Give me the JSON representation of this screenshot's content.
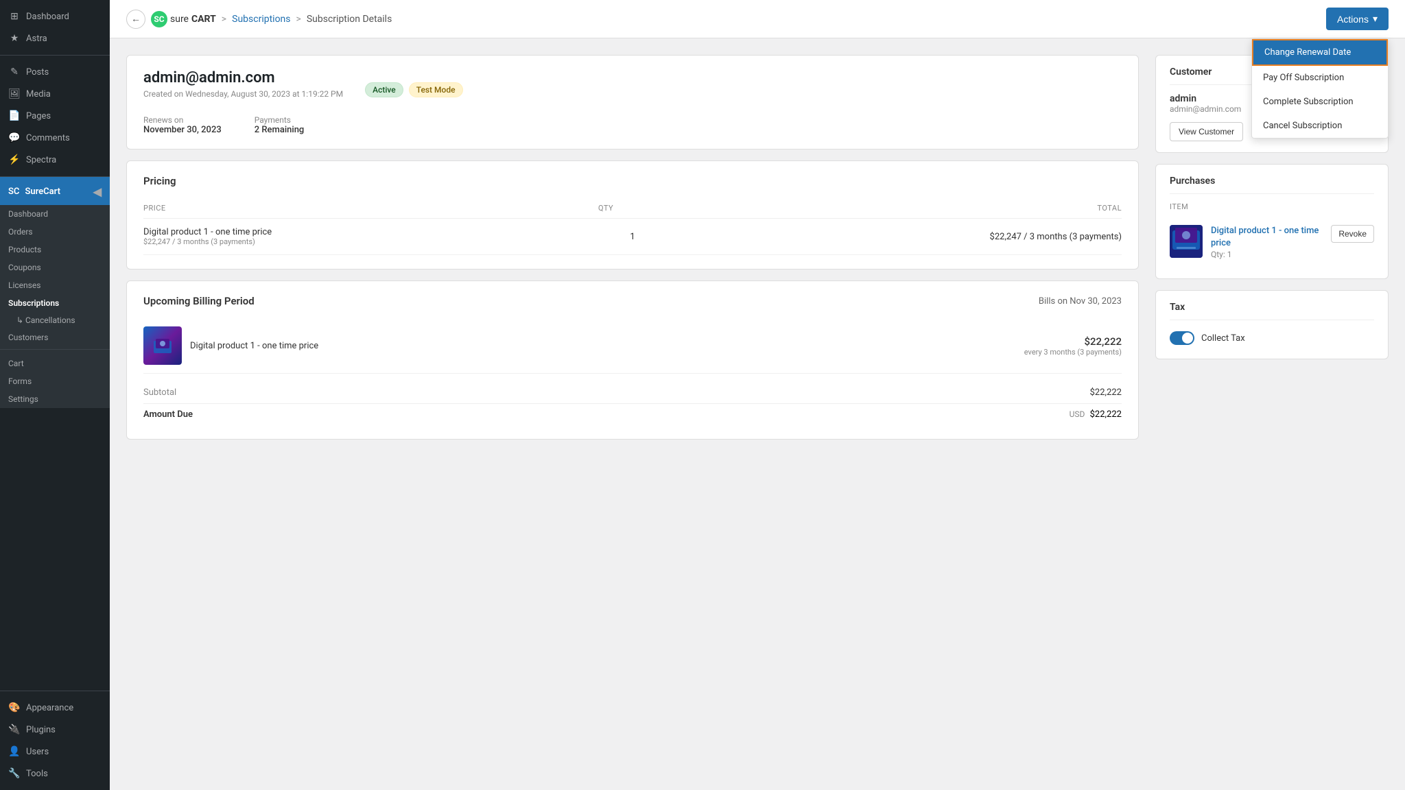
{
  "sidebar": {
    "top_items": [
      {
        "id": "dashboard",
        "label": "Dashboard",
        "icon": "⊞"
      },
      {
        "id": "astra",
        "label": "Astra",
        "icon": "★"
      }
    ],
    "wp_items": [
      {
        "id": "posts",
        "label": "Posts",
        "icon": "✎"
      },
      {
        "id": "media",
        "label": "Media",
        "icon": "🖼"
      },
      {
        "id": "pages",
        "label": "Pages",
        "icon": "📄"
      },
      {
        "id": "comments",
        "label": "Comments",
        "icon": "💬"
      },
      {
        "id": "spectra",
        "label": "Spectra",
        "icon": "⚡"
      }
    ],
    "surecart_label": "SureCart",
    "surecart_items": [
      {
        "id": "sc-dashboard",
        "label": "Dashboard"
      },
      {
        "id": "orders",
        "label": "Orders"
      },
      {
        "id": "products",
        "label": "Products"
      },
      {
        "id": "coupons",
        "label": "Coupons"
      },
      {
        "id": "licenses",
        "label": "Licenses"
      },
      {
        "id": "subscriptions",
        "label": "Subscriptions",
        "active": true
      },
      {
        "id": "cancellations",
        "label": "↳ Cancellations",
        "sub": true
      },
      {
        "id": "customers",
        "label": "Customers"
      }
    ],
    "bottom_items": [
      {
        "id": "cart",
        "label": "Cart"
      },
      {
        "id": "forms",
        "label": "Forms"
      },
      {
        "id": "settings",
        "label": "Settings"
      }
    ],
    "extra_items": [
      {
        "id": "appearance",
        "label": "Appearance",
        "icon": "🎨"
      },
      {
        "id": "plugins",
        "label": "Plugins",
        "icon": "🔌"
      },
      {
        "id": "users",
        "label": "Users",
        "icon": "👤"
      },
      {
        "id": "tools",
        "label": "Tools",
        "icon": "🔧"
      }
    ]
  },
  "topbar": {
    "back_label": "←",
    "logo_text": "sure",
    "logo_bold": "CART",
    "breadcrumb_sep": ">",
    "breadcrumb_1": "Subscriptions",
    "breadcrumb_2": "Subscription Details",
    "actions_label": "Actions",
    "actions_chevron": "▾"
  },
  "dropdown": {
    "items": [
      {
        "id": "change-renewal",
        "label": "Change Renewal Date",
        "highlighted": true
      },
      {
        "id": "pay-off",
        "label": "Pay Off Subscription",
        "highlighted": false
      },
      {
        "id": "complete",
        "label": "Complete Subscription",
        "highlighted": false
      },
      {
        "id": "cancel",
        "label": "Cancel Subscription",
        "highlighted": false
      }
    ]
  },
  "subscription": {
    "email": "admin@admin.com",
    "created": "Created on Wednesday, August 30, 2023 at 1:19:22 PM",
    "badge_active": "Active",
    "badge_test": "Test Mode",
    "renews_label": "Renews on",
    "renews_date": "November 30, 2023",
    "payments_label": "Payments",
    "payments_value": "2 Remaining"
  },
  "pricing": {
    "title": "Pricing",
    "col_price": "PRICE",
    "col_qty": "QTY",
    "col_total": "TOTAL",
    "rows": [
      {
        "name": "Digital product 1 - one time price",
        "price_label": "$22,247 / 3 months (3 payments)",
        "qty": "1",
        "total": "$22,247 / 3 months (3 payments)"
      }
    ]
  },
  "billing": {
    "title": "Upcoming Billing Period",
    "bills_on": "Bills on Nov 30, 2023",
    "item_name": "Digital product 1 - one time price",
    "item_amount": "$22,222",
    "item_freq": "every 3 months (3 payments)",
    "subtotal_label": "Subtotal",
    "subtotal_value": "$22,222",
    "amount_due_label": "Amount Due",
    "amount_due_currency": "USD",
    "amount_due_value": "$22,222"
  },
  "customer_panel": {
    "title": "Customer",
    "name": "admin",
    "email": "admin@admin.com",
    "view_button": "View Customer"
  },
  "purchases_panel": {
    "title": "Purchases",
    "col_item": "ITEM",
    "item_name": "Digital product 1 - one time price",
    "item_qty": "Qty: 1",
    "revoke_label": "Revoke"
  },
  "tax_panel": {
    "title": "Tax",
    "collect_label": "Collect Tax",
    "toggle_on": true
  }
}
